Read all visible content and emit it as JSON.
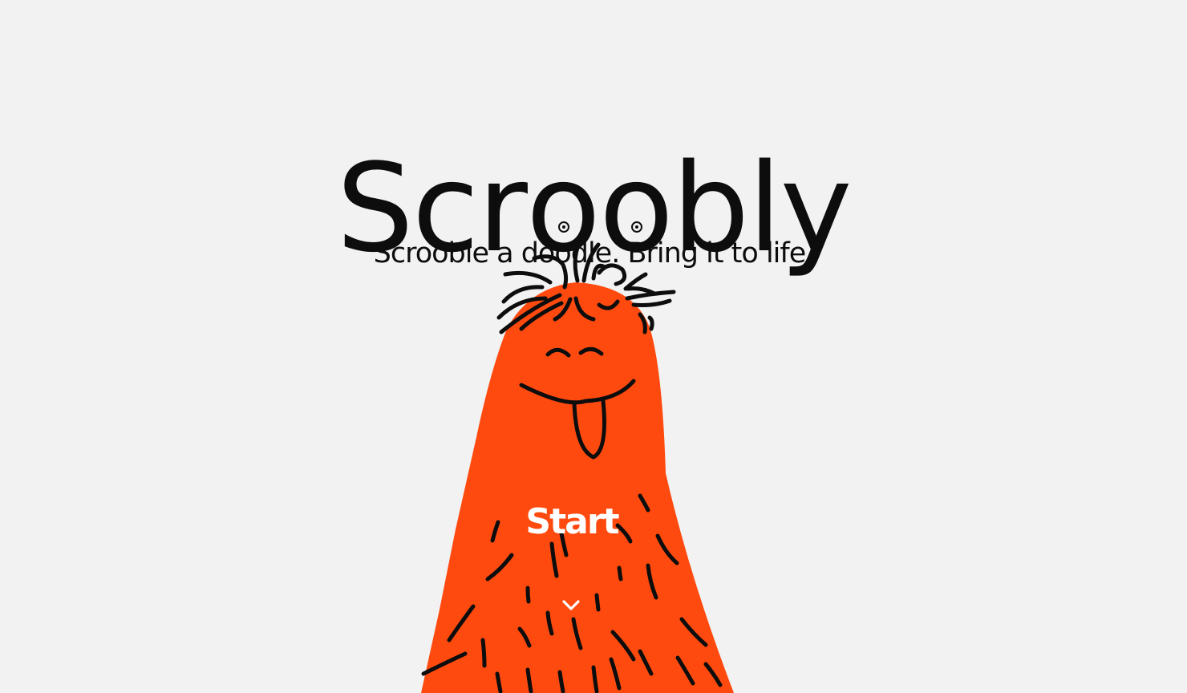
{
  "app": {
    "logo_letters": [
      "S",
      "c",
      "r",
      "o",
      "o",
      "b",
      "l",
      "y"
    ],
    "tagline": "Scrooble a doodle. Bring it to life."
  },
  "hero": {
    "start_label": "Start",
    "scroll_icon": "chevron-down-icon",
    "illustration": "doodle-monster"
  },
  "colors": {
    "background": "#f2f2f2",
    "text": "#0d0d0d",
    "monster": "#ff4a0f",
    "button_text": "#ffffff"
  }
}
